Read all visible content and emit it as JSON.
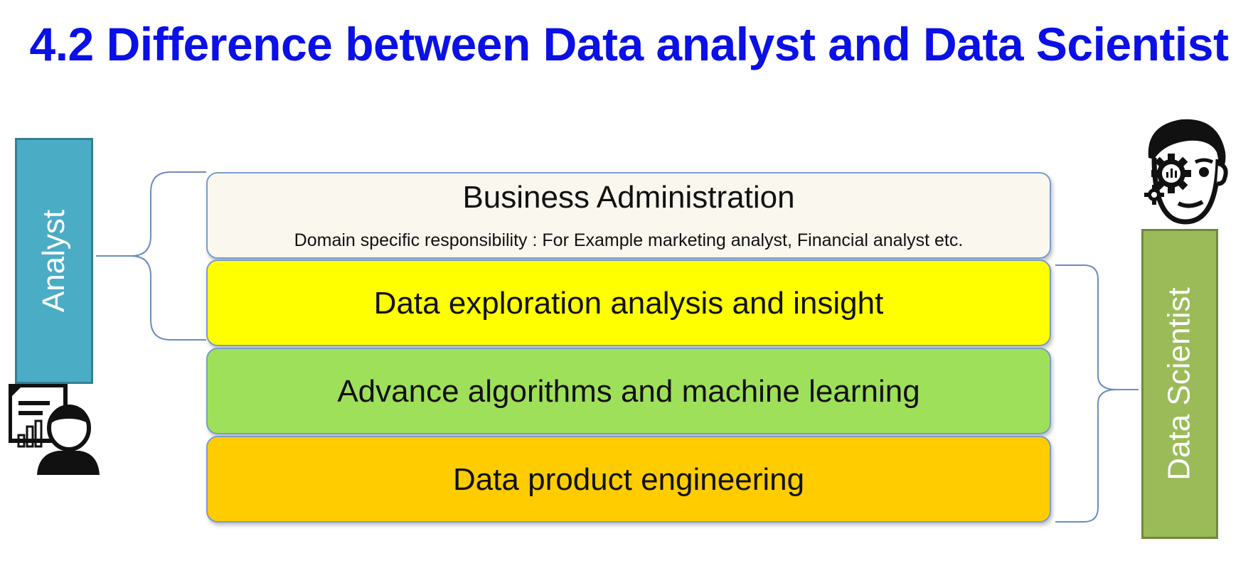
{
  "title": "4.2 Difference between Data analyst and Data Scientist",
  "roles": {
    "analyst": "Analyst",
    "data_scientist": "Data Scientist"
  },
  "layers": {
    "business": {
      "label": "Business Administration",
      "sub": "Domain specific responsibility : For Example marketing analyst, Financial analyst etc."
    },
    "exploration": {
      "label": "Data exploration analysis and insight"
    },
    "algorithms": {
      "label": "Advance algorithms and machine learning"
    },
    "product": {
      "label": "Data product engineering"
    }
  },
  "icons": {
    "analyst": "analyst-person-chart-icon",
    "scientist": "data-scientist-face-gear-icon"
  },
  "colors": {
    "title": "#0a10e6",
    "analyst": "#4bacc6",
    "data_scientist": "#9bbb59",
    "business": "#faf7ee",
    "exploration": "#ffff00",
    "algorithms": "#9fe05a",
    "product": "#ffcc00"
  }
}
